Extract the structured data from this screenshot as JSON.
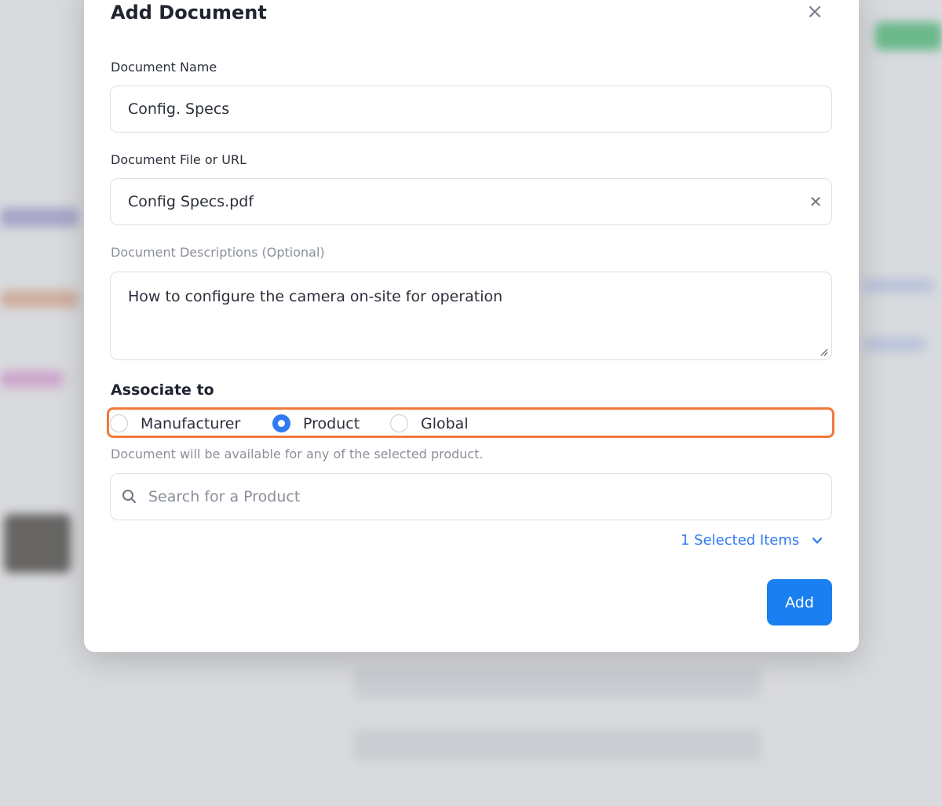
{
  "modal": {
    "title": "Add Document",
    "close_icon": "close-icon"
  },
  "fields": {
    "document_name_label": "Document Name",
    "document_name_value": "Config. Specs",
    "document_file_label": "Document File or URL",
    "document_file_value": "Config Specs.pdf",
    "description_label": "Document Descriptions (Optional)",
    "description_value": "How to configure the camera on-site for operation"
  },
  "associate": {
    "label": "Associate to",
    "options": [
      {
        "label": "Manufacturer",
        "selected": false
      },
      {
        "label": "Product",
        "selected": true
      },
      {
        "label": "Global",
        "selected": false
      }
    ],
    "hint": "Document will be available for any of the selected product."
  },
  "search": {
    "placeholder": "Search for a Product",
    "icon": "search-icon"
  },
  "selection": {
    "label": "1 Selected Items",
    "icon": "chevron-down-icon"
  },
  "actions": {
    "add_label": "Add"
  },
  "colors": {
    "accent": "#1a7ff0",
    "highlight": "#f07a3a"
  }
}
